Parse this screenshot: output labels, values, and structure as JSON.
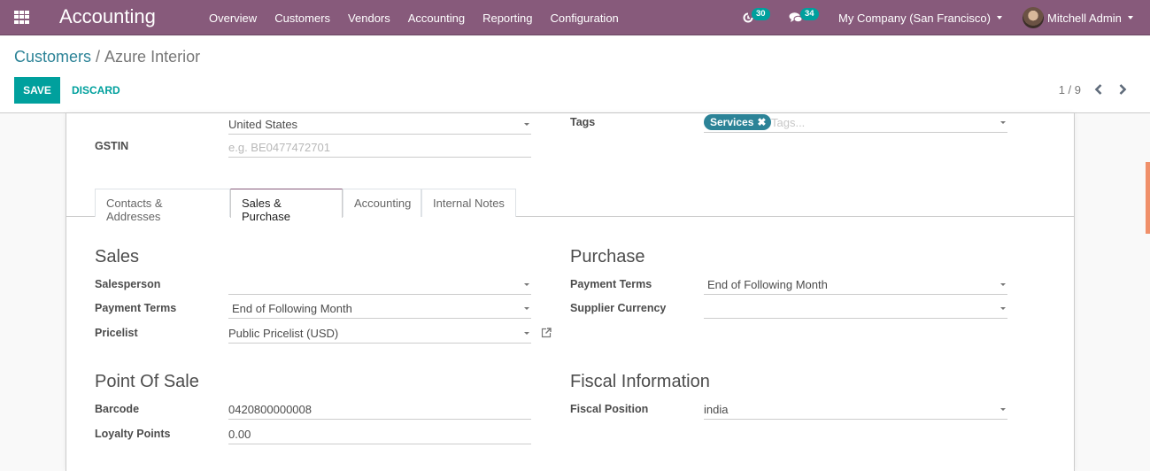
{
  "navbar": {
    "app_title": "Accounting",
    "menu": [
      "Overview",
      "Customers",
      "Vendors",
      "Accounting",
      "Reporting",
      "Configuration"
    ],
    "activity_count": "30",
    "messages_count": "34",
    "company": "My Company (San Francisco)",
    "user": "Mitchell Admin",
    "brand_color": "#875a7b"
  },
  "control": {
    "breadcrumb_parent": "Customers",
    "breadcrumb_separator": "/",
    "breadcrumb_current": "Azure Interior",
    "save_label": "SAVE",
    "discard_label": "DISCARD",
    "pager": "1 / 9"
  },
  "form": {
    "country_value": "United States",
    "gstin_label": "GSTIN",
    "gstin_placeholder": "e.g. BE0477472701",
    "tags_label": "Tags",
    "tags": [
      "Services"
    ],
    "tags_placeholder": "Tags...",
    "tabs": [
      "Contacts & Addresses",
      "Sales & Purchase",
      "Accounting",
      "Internal Notes"
    ],
    "active_tab": "Sales & Purchase",
    "sales": {
      "title": "Sales",
      "salesperson_label": "Salesperson",
      "salesperson_value": "",
      "payment_terms_label": "Payment Terms",
      "payment_terms_value": "End of Following Month",
      "pricelist_label": "Pricelist",
      "pricelist_value": "Public Pricelist (USD)"
    },
    "purchase": {
      "title": "Purchase",
      "payment_terms_label": "Payment Terms",
      "payment_terms_value": "End of Following Month",
      "supplier_currency_label": "Supplier Currency",
      "supplier_currency_value": ""
    },
    "pos": {
      "title": "Point Of Sale",
      "barcode_label": "Barcode",
      "barcode_value": "0420800000008",
      "loyalty_label": "Loyalty Points",
      "loyalty_value": "0.00"
    },
    "fiscal": {
      "title": "Fiscal Information",
      "fiscal_position_label": "Fiscal Position",
      "fiscal_position_value": "india"
    }
  }
}
